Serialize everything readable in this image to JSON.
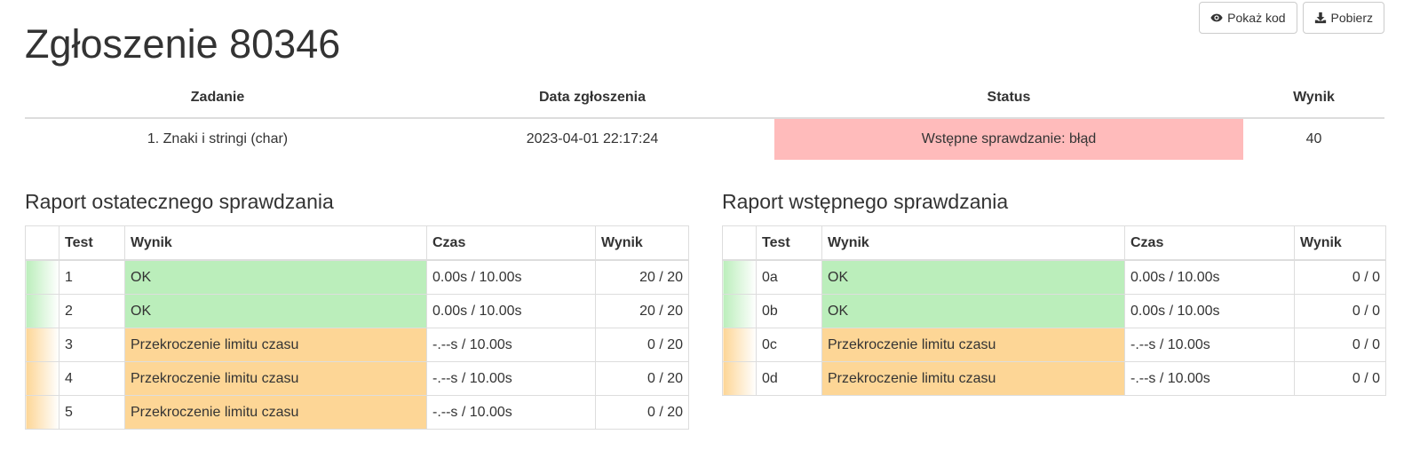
{
  "toolbar": {
    "show_code_label": "Pokaż kod",
    "download_label": "Pobierz"
  },
  "page_title": "Zgłoszenie 80346",
  "summary": {
    "headers": [
      "Zadanie",
      "Data zgłoszenia",
      "Status",
      "Wynik"
    ],
    "task": "1. Znaki i stringi (char)",
    "date": "2023-04-01 22:17:24",
    "status": "Wstępne sprawdzanie: błąd",
    "score": "40"
  },
  "final_report": {
    "title": "Raport ostatecznego sprawdzania",
    "headers": [
      "",
      "Test",
      "Wynik",
      "Czas",
      "Wynik"
    ],
    "rows": [
      {
        "test": "1",
        "result": "OK",
        "time": "0.00s / 10.00s",
        "score": "20 / 20",
        "status": "ok"
      },
      {
        "test": "2",
        "result": "OK",
        "time": "0.00s / 10.00s",
        "score": "20 / 20",
        "status": "ok"
      },
      {
        "test": "3",
        "result": "Przekroczenie limitu czasu",
        "time": "-.--s / 10.00s",
        "score": "0 / 20",
        "status": "tle"
      },
      {
        "test": "4",
        "result": "Przekroczenie limitu czasu",
        "time": "-.--s / 10.00s",
        "score": "0 / 20",
        "status": "tle"
      },
      {
        "test": "5",
        "result": "Przekroczenie limitu czasu",
        "time": "-.--s / 10.00s",
        "score": "0 / 20",
        "status": "tle"
      }
    ]
  },
  "initial_report": {
    "title": "Raport wstępnego sprawdzania",
    "headers": [
      "",
      "Test",
      "Wynik",
      "Czas",
      "Wynik"
    ],
    "rows": [
      {
        "test": "0a",
        "result": "OK",
        "time": "0.00s / 10.00s",
        "score": "0 / 0",
        "status": "ok"
      },
      {
        "test": "0b",
        "result": "OK",
        "time": "0.00s / 10.00s",
        "score": "0 / 0",
        "status": "ok"
      },
      {
        "test": "0c",
        "result": "Przekroczenie limitu czasu",
        "time": "-.--s / 10.00s",
        "score": "0 / 0",
        "status": "tle"
      },
      {
        "test": "0d",
        "result": "Przekroczenie limitu czasu",
        "time": "-.--s / 10.00s",
        "score": "0 / 0",
        "status": "tle"
      }
    ]
  },
  "colors": {
    "ok": "#bbeebb",
    "tle": "#fdd696",
    "error_status": "#ffbbbb"
  },
  "icons": {
    "show_code": "eye-icon",
    "download": "download-icon"
  }
}
